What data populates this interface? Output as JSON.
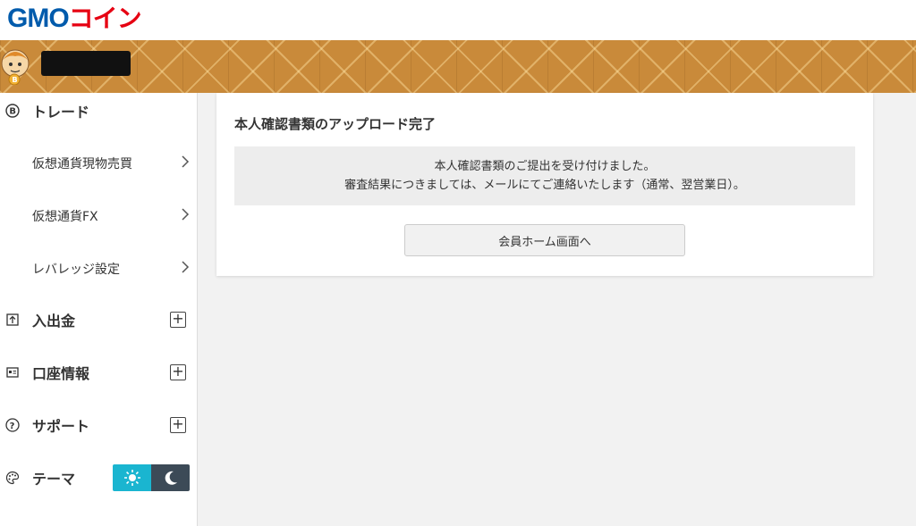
{
  "header": {
    "logo_latin": "GMO",
    "logo_kana": "コイン"
  },
  "sidebar": {
    "trade": {
      "label": "トレード",
      "icon": "bitcoin-icon",
      "items": [
        {
          "label": "仮想通貨現物売買"
        },
        {
          "label": "仮想通貨FX"
        },
        {
          "label": "レバレッジ設定"
        }
      ]
    },
    "sections": [
      {
        "label": "入出金",
        "icon": "deposit-withdraw-icon"
      },
      {
        "label": "口座情報",
        "icon": "account-card-icon"
      },
      {
        "label": "サポート",
        "icon": "question-icon"
      }
    ],
    "theme": {
      "label": "テーマ",
      "icon": "palette-icon",
      "options": [
        "light-sun-icon",
        "dark-moon-icon"
      ],
      "selected": "light"
    }
  },
  "main": {
    "title": "本人確認書類のアップロード完了",
    "notice_line1": "本人確認書類のご提出を受け付けました。",
    "notice_line2": "審査結果につきましては、メールにてご連絡いたします（通常、翌営業日）。",
    "home_button": "会員ホーム画面へ"
  },
  "colors": {
    "brand_blue": "#005bac",
    "brand_red": "#e60012",
    "banner": "#c98a3a",
    "theme_light": "#1ab5d0",
    "theme_dark": "#3c4a57"
  }
}
